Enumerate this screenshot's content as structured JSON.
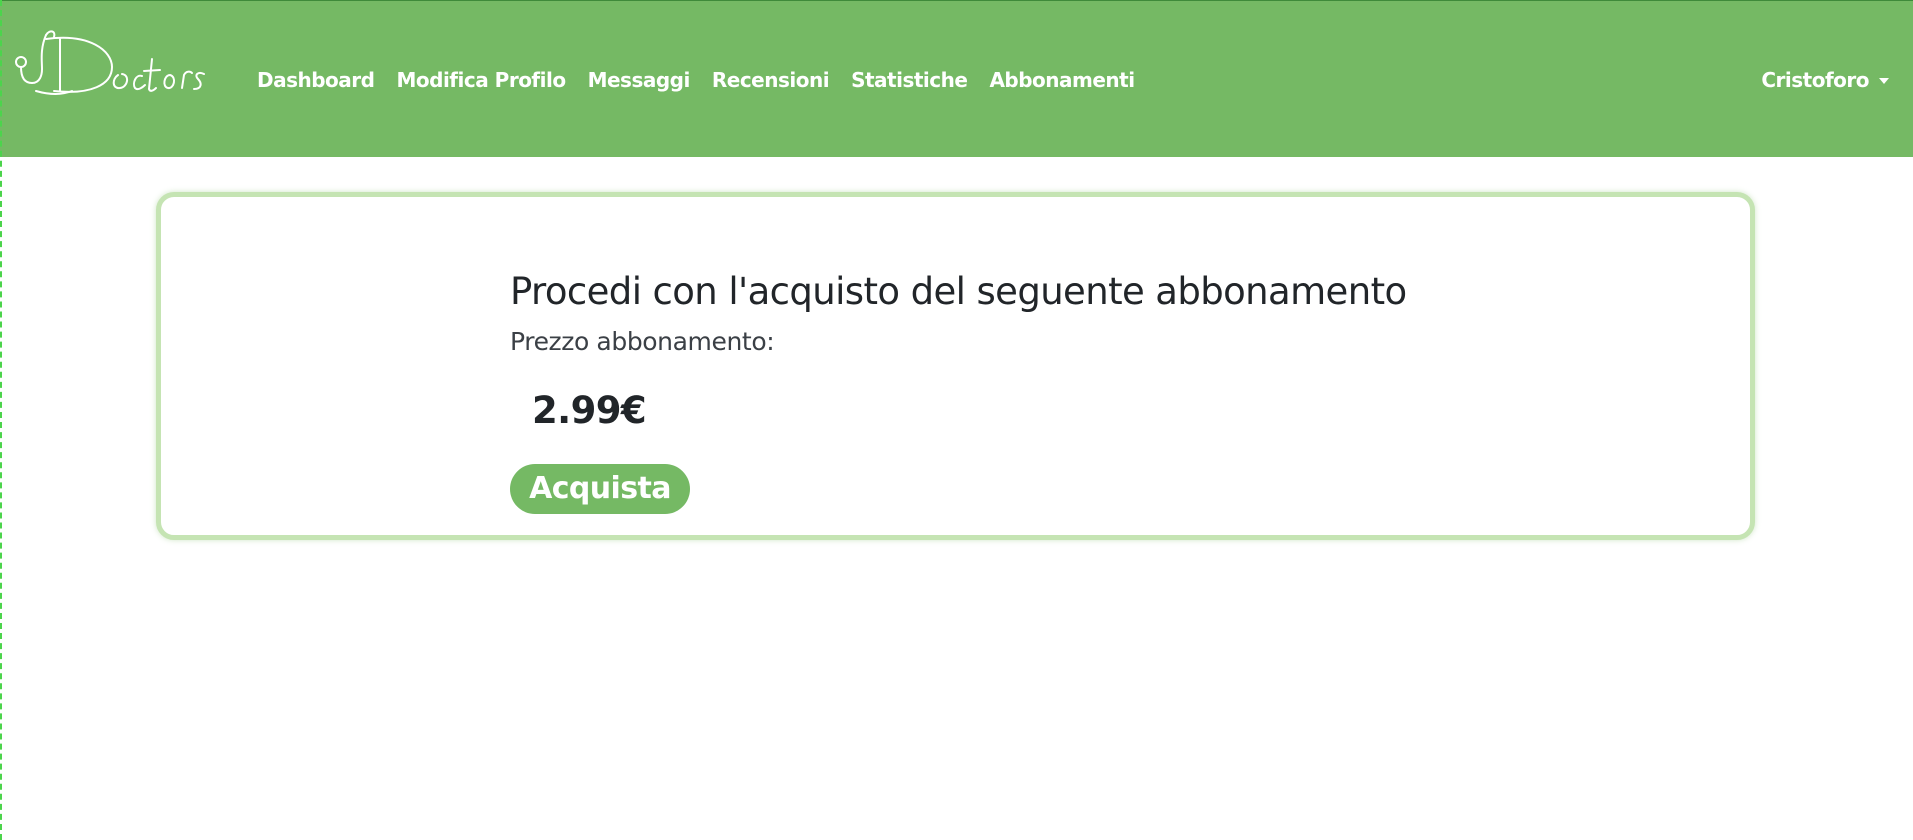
{
  "navbar": {
    "brand": "Doctors",
    "links": [
      {
        "label": "Dashboard"
      },
      {
        "label": "Modifica Profilo"
      },
      {
        "label": "Messaggi"
      },
      {
        "label": "Recensioni"
      },
      {
        "label": "Statistiche"
      },
      {
        "label": "Abbonamenti"
      }
    ],
    "user": {
      "name": "Cristoforo"
    },
    "colors": {
      "background": "#75b964",
      "text": "#ffffff"
    }
  },
  "purchase": {
    "title": "Procedi con l'acquisto del seguente abbonamento",
    "price_label": "Prezzo abbonamento:",
    "price": "2.99€",
    "buy_label": "Acquista",
    "colors": {
      "card_border": "#c5e4b3",
      "button": "#75b964"
    }
  }
}
